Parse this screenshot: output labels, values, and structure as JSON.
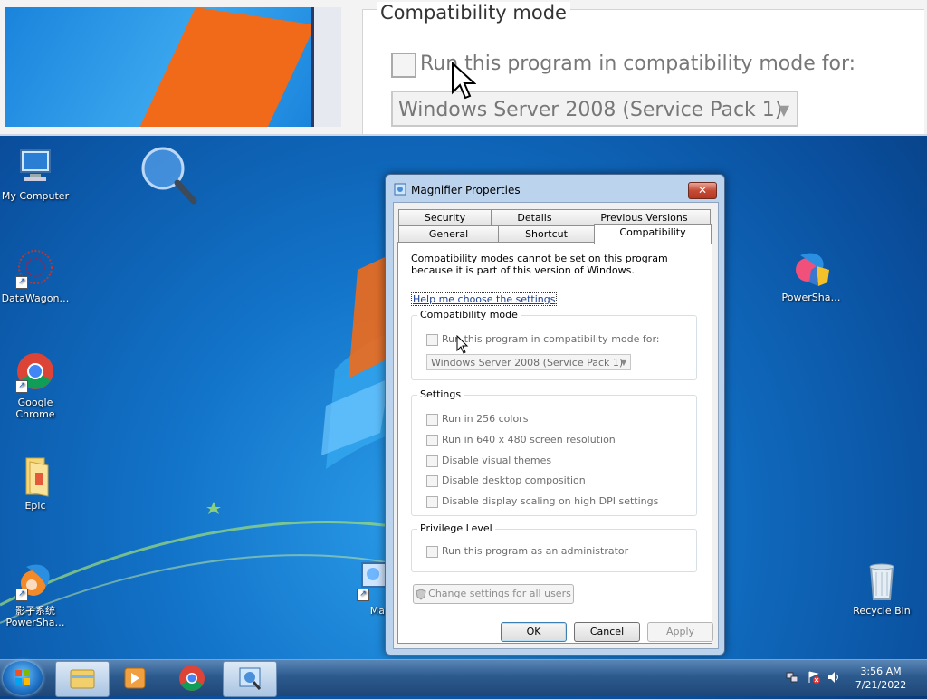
{
  "magnifier": {
    "legend": "Compatibility mode",
    "checkbox_label": "Run this program in compatibility mode for:",
    "combo_value": "Windows Server 2008 (Service Pack 1)"
  },
  "desktop": {
    "icons": [
      {
        "label": "My Computer",
        "icon": "computer-icon"
      },
      {
        "label": "DataWagon…",
        "icon": "datawagon-icon"
      },
      {
        "label": "Google Chrome",
        "icon": "chrome-icon"
      },
      {
        "label": "Epic",
        "icon": "folder-icon"
      },
      {
        "label": "影子系统 PowerSha…",
        "icon": "powershadow-icon"
      },
      {
        "label": "PowerSha…",
        "icon": "powershadow-icon"
      },
      {
        "label": "Recycle Bin",
        "icon": "recycle-bin-icon"
      },
      {
        "label": "Mag",
        "icon": "magnifier-shortcut-icon"
      }
    ]
  },
  "dialog": {
    "title": "Magnifier Properties",
    "close_label": "✕",
    "tabs_back": [
      "Security",
      "Details",
      "Previous Versions"
    ],
    "tabs_front": [
      "General",
      "Shortcut",
      "Compatibility"
    ],
    "active_tab": "Compatibility",
    "info_text": "Compatibility modes cannot be set on this program because it is part of this version of Windows.",
    "help_link": "Help me choose the settings",
    "compat_group": {
      "label": "Compatibility mode",
      "checkbox": "Run this program in compatibility mode for:",
      "combo_value": "Windows Server 2008 (Service Pack 1)"
    },
    "settings_group": {
      "label": "Settings",
      "items": [
        "Run in 256 colors",
        "Run in 640 x 480 screen resolution",
        "Disable visual themes",
        "Disable desktop composition",
        "Disable display scaling on high DPI settings"
      ]
    },
    "privilege_group": {
      "label": "Privilege Level",
      "checkbox": "Run this program as an administrator"
    },
    "change_all_button": "Change settings for all users",
    "ok_button": "OK",
    "cancel_button": "Cancel",
    "apply_button": "Apply"
  },
  "taskbar": {
    "items": [
      "windows-explorer-icon",
      "media-player-icon",
      "chrome-icon",
      "magnifier-icon"
    ],
    "time": "3:56 AM",
    "date": "7/21/2022"
  },
  "colors": {
    "desktop_blue": "#1273c8",
    "link_blue": "#1b3f91",
    "close_red": "#c44b36"
  }
}
